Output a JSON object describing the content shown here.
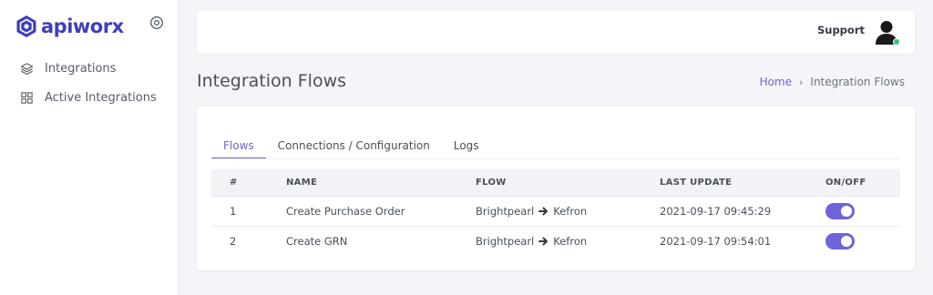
{
  "brand": {
    "name": "apiworx",
    "color": "#3f3fb8"
  },
  "sidebar": {
    "items": [
      {
        "label": "Integrations",
        "icon": "layers-icon"
      },
      {
        "label": "Active Integrations",
        "icon": "grid-icon"
      }
    ]
  },
  "header": {
    "support_label": "Support",
    "status": "online"
  },
  "page": {
    "title": "Integration Flows",
    "breadcrumb": {
      "home": "Home",
      "current": "Integration Flows"
    }
  },
  "tabs": [
    {
      "label": "Flows",
      "active": true
    },
    {
      "label": "Connections / Configuration",
      "active": false
    },
    {
      "label": "Logs",
      "active": false
    }
  ],
  "table": {
    "headers": [
      "#",
      "NAME",
      "FLOW",
      "LAST UPDATE",
      "ON/OFF"
    ],
    "rows": [
      {
        "num": "1",
        "name": "Create Purchase Order",
        "flow_from": "Brightpearl",
        "flow_to": "Kefron",
        "last_update": "2021-09-17 09:45:29",
        "on": true
      },
      {
        "num": "2",
        "name": "Create GRN",
        "flow_from": "Brightpearl",
        "flow_to": "Kefron",
        "last_update": "2021-09-17 09:54:01",
        "on": true
      }
    ]
  },
  "colors": {
    "accent": "#6f63d8",
    "online": "#3cc36a",
    "background": "#f4f5f9"
  }
}
